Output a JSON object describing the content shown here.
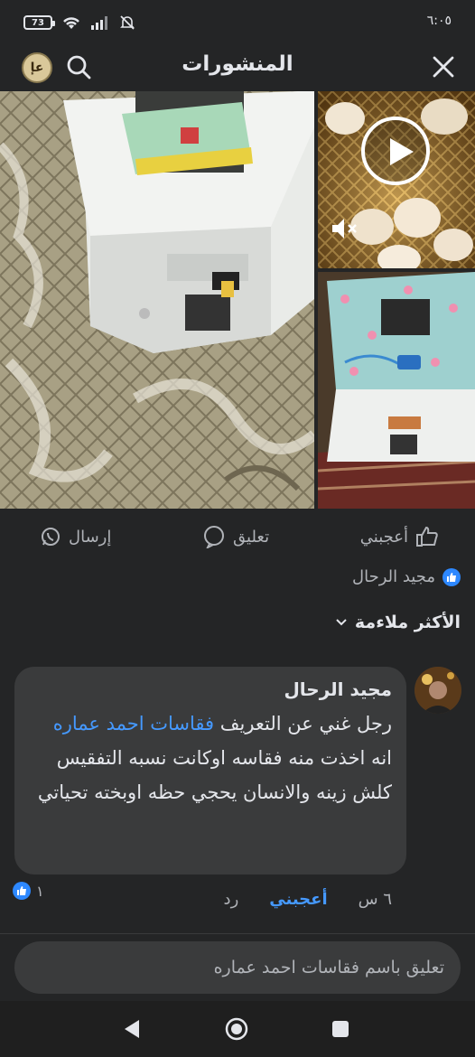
{
  "status_bar": {
    "battery_level": "73",
    "time": "٦:٠٥"
  },
  "header": {
    "title": "المنشورات",
    "logo_text": "عإ"
  },
  "media": {
    "photos": [
      "incubator-top-view-photo",
      "eggs-video-thumbnail",
      "incubator-open-photo"
    ],
    "video_muted": true
  },
  "post_actions": {
    "like_label": "أعجبني",
    "comment_label": "تعليق",
    "send_label": "إرسال"
  },
  "liker_name": "مجيد الرحال",
  "sort": {
    "label": "الأكثر ملاءمة"
  },
  "comment": {
    "author": "مجيد الرحال",
    "text_part1": "رجل غني عن التعريف ",
    "mention": "فقاسات احمد عماره",
    "text_part2": "  انه اخذت منه فقاسه اوكانت نسبه التفقيس كلش زينه والانسان يحجي حظه اوبخته تحياتي",
    "time": "٦ س",
    "like_label": "أعجبني",
    "reply_label": "رد",
    "reaction_count": "١"
  },
  "composer": {
    "placeholder": "تعليق باسم فقاسات احمد عماره"
  },
  "colors": {
    "background": "#242526",
    "bubble": "#3a3b3c",
    "link": "#4599ff",
    "like_badge": "#2d88ff"
  }
}
